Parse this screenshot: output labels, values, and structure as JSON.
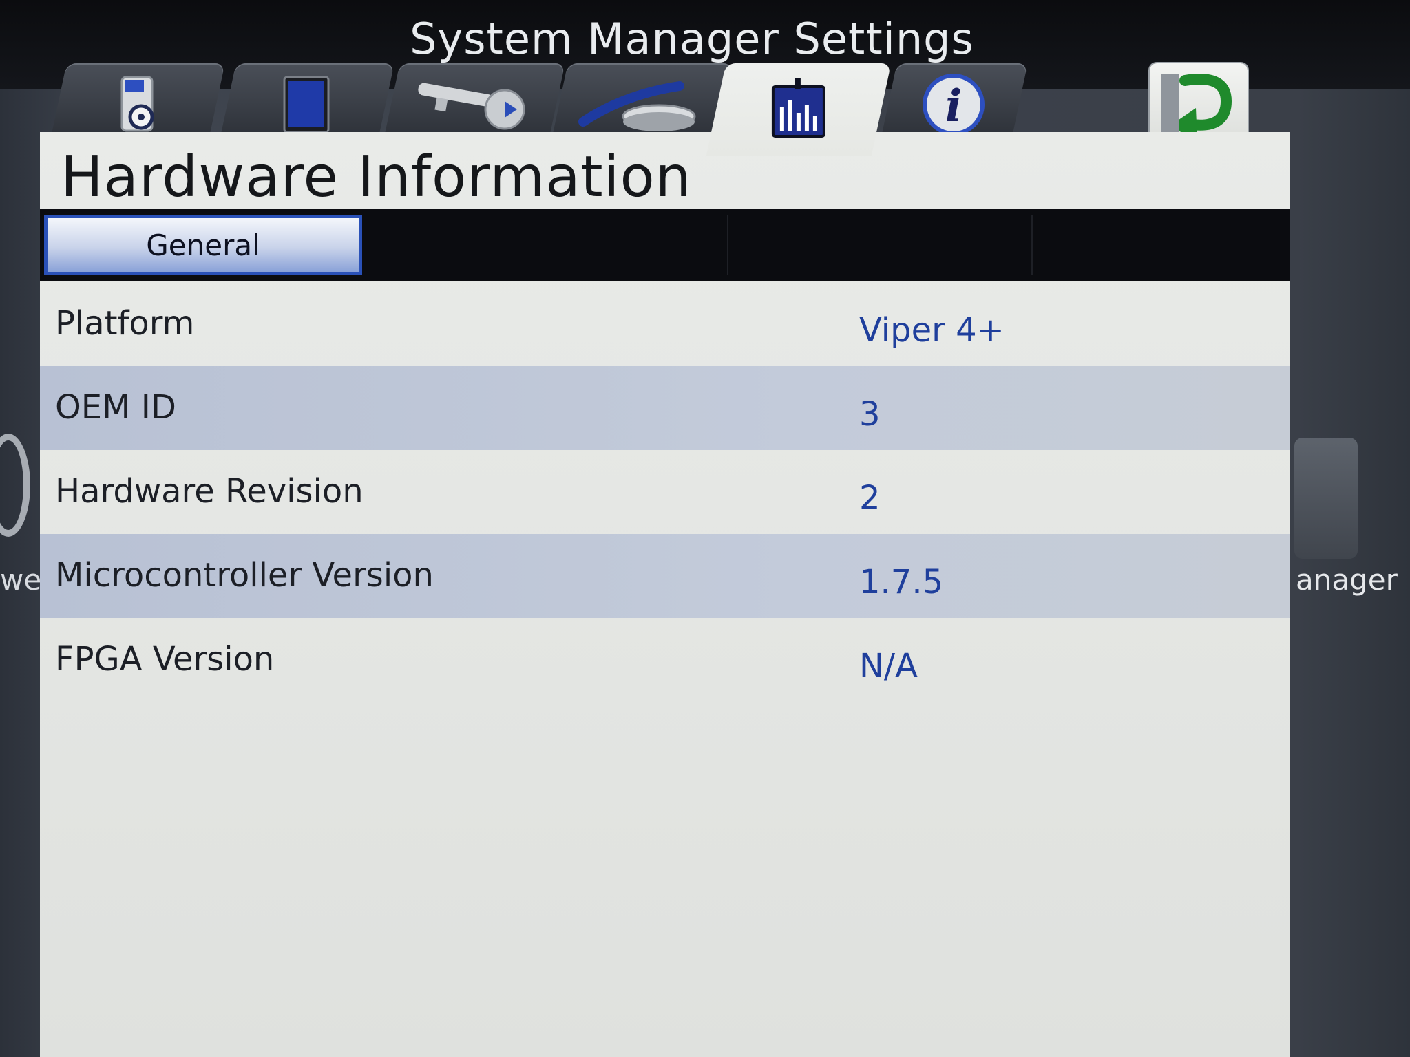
{
  "window": {
    "title": "System Manager Settings"
  },
  "tabs": [
    {
      "id": "device",
      "icon": "device-settings-icon"
    },
    {
      "id": "display",
      "icon": "display-icon"
    },
    {
      "id": "keys",
      "icon": "key-icon"
    },
    {
      "id": "equipment",
      "icon": "implement-icon"
    },
    {
      "id": "hardware",
      "icon": "bar-chart-icon",
      "active": true
    },
    {
      "id": "info",
      "icon": "info-icon",
      "label": "i"
    }
  ],
  "back_button": {
    "icon": "return-arrow-icon"
  },
  "page": {
    "title": "Hardware Information"
  },
  "subtabs": {
    "active_label": "General"
  },
  "rows": [
    {
      "label": "Platform",
      "value": "Viper 4+"
    },
    {
      "label": "OEM ID",
      "value": "3"
    },
    {
      "label": "Hardware Revision",
      "value": "2"
    },
    {
      "label": "Microcontroller Version",
      "value": "1.7.5"
    },
    {
      "label": "FPGA Version",
      "value": "N/A"
    }
  ],
  "background": {
    "right_label": "anager",
    "left_label": "we"
  },
  "colors": {
    "accent_blue": "#2a51b8",
    "value_blue": "#1f3f9c",
    "back_arrow_green": "#1f8a2c"
  }
}
